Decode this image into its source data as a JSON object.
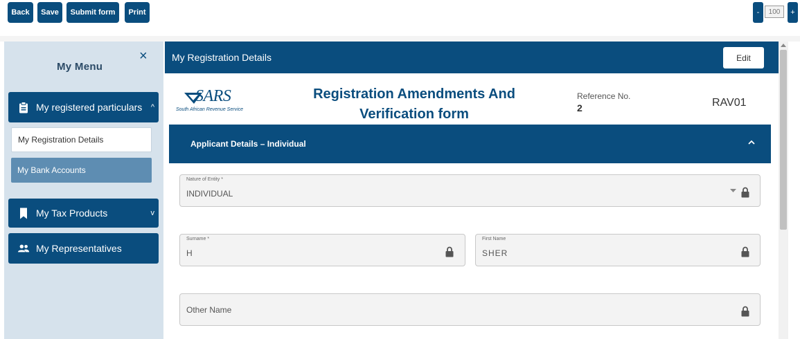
{
  "toolbar": {
    "back_label": "Back",
    "save_label": "Save",
    "submit_label": "Submit form",
    "print_label": "Print",
    "zoom_minus": "-",
    "zoom_value": "100",
    "zoom_plus": "+"
  },
  "sidebar": {
    "title": "My Menu",
    "close_glyph": "×",
    "sections": [
      {
        "label": "My registered particulars",
        "icon": "clipboard-icon",
        "chevron": "^"
      },
      {
        "label": "My Tax Products",
        "icon": "bookmark-icon",
        "chevron": "v"
      },
      {
        "label": "My Representatives",
        "icon": "people-icon"
      }
    ],
    "items": [
      {
        "label": "My Registration Details"
      },
      {
        "label": "My Bank Accounts"
      }
    ]
  },
  "main": {
    "header_title": "My Registration Details",
    "edit_label": "Edit",
    "logo_text": "SARS",
    "logo_subtitle": "South African Revenue Service",
    "form_title": "Registration Amendments And Verification form",
    "reference_label": "Reference No.",
    "reference_value": "2",
    "form_code": "RAV01",
    "section_title": "Applicant Details – Individual",
    "fields": {
      "nature_label": "Nature of Entity *",
      "nature_value": "INDIVIDUAL",
      "surname_label": "Surname *",
      "surname_value": "H",
      "firstname_label": "First Name",
      "firstname_value": "SHER",
      "othername_label": "Other Name"
    }
  },
  "colors": {
    "brand_blue": "#0a4d7e",
    "sidebar_bg": "#d6e2ec",
    "sub_item_bg": "#5e8db2"
  }
}
